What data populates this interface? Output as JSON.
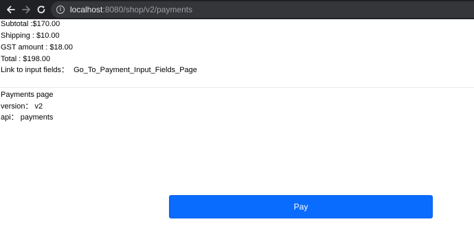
{
  "browser": {
    "url_host": "localhost",
    "url_rest": ":8080/shop/v2/payments"
  },
  "summary": {
    "subtotal": "Subtotal :$170.00",
    "shipping": "Shipping : $10.00",
    "gst": "GST amount  : $18.00",
    "total": "Total : $198.00",
    "link_label": "Link to input fields：",
    "link_text": "Go_To_Payment_Input_Fields_Page"
  },
  "page_info": {
    "title": "Payments page",
    "version": "version： v2",
    "api": "api： payments"
  },
  "pay_button": {
    "label": "Pay"
  }
}
